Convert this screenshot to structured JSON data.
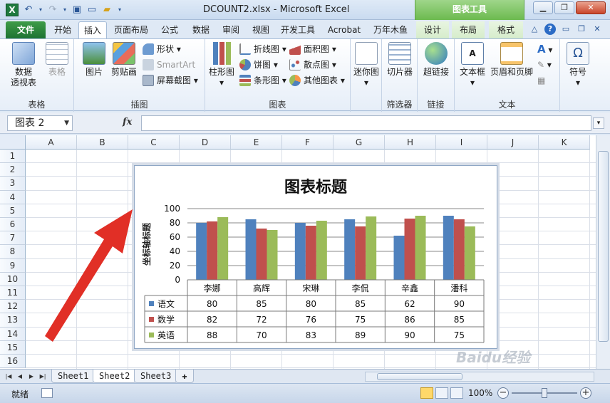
{
  "window": {
    "title": "DCOUNT2.xlsx - Microsoft Excel",
    "context_tab_group": "图表工具"
  },
  "tabs": [
    {
      "label": "文件"
    },
    {
      "label": "开始"
    },
    {
      "label": "插入"
    },
    {
      "label": "页面布局"
    },
    {
      "label": "公式"
    },
    {
      "label": "数据"
    },
    {
      "label": "审阅"
    },
    {
      "label": "视图"
    },
    {
      "label": "开发工具"
    },
    {
      "label": "Acrobat"
    },
    {
      "label": "万年木鱼"
    },
    {
      "label": "设计"
    },
    {
      "label": "布局"
    },
    {
      "label": "格式"
    }
  ],
  "ribbon": {
    "groups": {
      "tables": "表格",
      "illustrations": "插图",
      "charts": "图表",
      "slicers": "筛选器",
      "links": "链接",
      "text": "文本"
    },
    "buttons": {
      "pivot_line1": "数据",
      "pivot_line2": "透视表",
      "table": "表格",
      "picture": "图片",
      "clipart": "剪贴画",
      "shapes": "形状",
      "smartart": "SmartArt",
      "screenshot": "屏幕截图",
      "column": "柱形图",
      "line": "折线图",
      "pie": "饼图",
      "bar": "条形图",
      "area": "面积图",
      "scatter": "散点图",
      "other": "其他图表",
      "sparklines": "迷你图",
      "slicer": "切片器",
      "hyperlink": "超链接",
      "textbox": "文本框",
      "header_footer": "页眉和页脚",
      "symbol": "符号"
    }
  },
  "formula_bar": {
    "name_box": "图表 2",
    "fx": "fx",
    "formula": ""
  },
  "columns": [
    "A",
    "B",
    "C",
    "D",
    "E",
    "F",
    "G",
    "H",
    "I",
    "J",
    "K"
  ],
  "rows": [
    "1",
    "2",
    "3",
    "4",
    "5",
    "6",
    "7",
    "8",
    "9",
    "10",
    "11",
    "12",
    "13",
    "14",
    "15",
    "16"
  ],
  "chart_data": {
    "type": "bar",
    "title": "图表标题",
    "ylabel": "坐标轴标题",
    "xlabel": "",
    "ylim": [
      0,
      100
    ],
    "yticks": [
      0,
      20,
      40,
      60,
      80,
      100
    ],
    "categories": [
      "李娜",
      "高辉",
      "宋琳",
      "李侃",
      "辛鑫",
      "潘科"
    ],
    "series": [
      {
        "name": "语文",
        "color": "#4f81bd",
        "values": [
          80,
          85,
          80,
          85,
          62,
          90
        ]
      },
      {
        "name": "数学",
        "color": "#c0504d",
        "values": [
          82,
          72,
          76,
          75,
          86,
          85
        ]
      },
      {
        "name": "英语",
        "color": "#9bbb59",
        "values": [
          88,
          70,
          83,
          89,
          90,
          75
        ]
      }
    ],
    "legend": "data-table",
    "grid": true
  },
  "sheets": [
    "Sheet1",
    "Sheet2",
    "Sheet3"
  ],
  "active_sheet": "Sheet2",
  "status": {
    "ready": "就绪",
    "zoom": "100%"
  },
  "watermark": "Baidu经验"
}
